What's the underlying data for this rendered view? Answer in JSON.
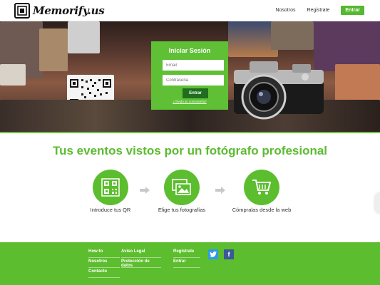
{
  "header": {
    "logo_text": "Memorify.us",
    "nav": [
      {
        "label": "Nosotros"
      },
      {
        "label": "Registrate"
      }
    ],
    "enter_label": "Entrar"
  },
  "login": {
    "title": "Iniciar Sesión",
    "email_placeholder": "Email",
    "password_placeholder": "Contraseña",
    "submit_label": "Entrar",
    "forgot_label": "¿Olvidó su contraseña?"
  },
  "headline": "Tus eventos vistos por un fotógrafo profesional",
  "steps": [
    {
      "label": "Introduce tus QR",
      "icon": "qr-code-icon"
    },
    {
      "label": "Elige tus fotografías",
      "icon": "photos-icon"
    },
    {
      "label": "Cómpralas desde la web",
      "icon": "shopping-cart-icon"
    }
  ],
  "footer": {
    "col1": [
      "How-to",
      "Nosotros",
      "Contacto"
    ],
    "col2": [
      "Aviso Legal",
      "Protección de datos"
    ],
    "col3": [
      "Registrate",
      "Entrar"
    ],
    "social": {
      "twitter": "t",
      "facebook": "f"
    }
  },
  "colors": {
    "brand_green": "#5cbd2e",
    "dark_green": "#1f6d1e",
    "twitter": "#2f9be6",
    "facebook": "#3b5998"
  }
}
